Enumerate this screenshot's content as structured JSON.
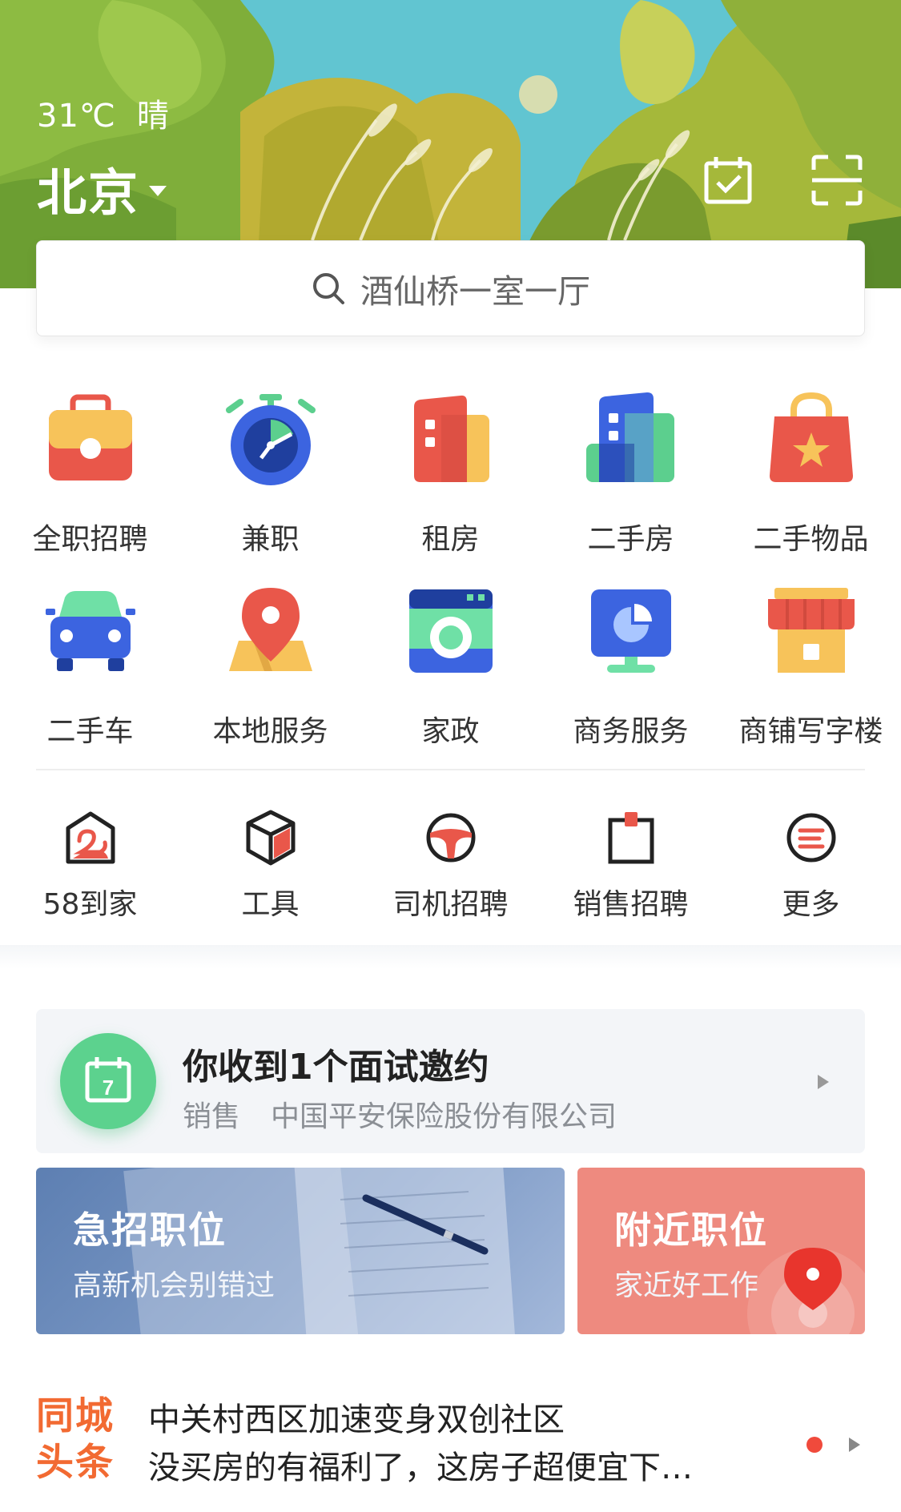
{
  "header": {
    "temperature": "31℃",
    "weather": "晴",
    "city": "北京"
  },
  "search": {
    "placeholder": "酒仙桥一室一厅"
  },
  "grid_row1": [
    {
      "label": "全职招聘",
      "icon": "briefcase-icon"
    },
    {
      "label": "兼职",
      "icon": "stopwatch-icon"
    },
    {
      "label": "租房",
      "icon": "building-icon"
    },
    {
      "label": "二手房",
      "icon": "apartment-icon"
    },
    {
      "label": "二手物品",
      "icon": "shopping-bag-icon"
    }
  ],
  "grid_row2": [
    {
      "label": "二手车",
      "icon": "car-icon"
    },
    {
      "label": "本地服务",
      "icon": "location-map-icon"
    },
    {
      "label": "家政",
      "icon": "washing-machine-icon"
    },
    {
      "label": "商务服务",
      "icon": "monitor-chart-icon"
    },
    {
      "label": "商铺写字楼",
      "icon": "storefront-icon"
    }
  ],
  "grid_row3": [
    {
      "label": "58到家",
      "icon": "swan-home-icon"
    },
    {
      "label": "工具",
      "icon": "cube-icon"
    },
    {
      "label": "司机招聘",
      "icon": "steering-wheel-icon"
    },
    {
      "label": "销售招聘",
      "icon": "clipboard-icon"
    },
    {
      "label": "更多",
      "icon": "menu-circle-icon"
    }
  ],
  "invite": {
    "title": "你收到1个面试邀约",
    "position": "销售",
    "company": "中国平安保险股份有限公司",
    "calendar_day": "7"
  },
  "promos": {
    "urgent": {
      "title": "急招职位",
      "subtitle": "高新机会别错过"
    },
    "nearby": {
      "title": "附近职位",
      "subtitle": "家近好工作"
    }
  },
  "news": {
    "logo_line1": "同城",
    "logo_line2": "头条",
    "headline1": "中关村西区加速变身双创社区",
    "headline2": "没买房的有福利了，这房子超便宜下…"
  },
  "colors": {
    "accent_red": "#f04a3c",
    "invite_green": "#5cd28e",
    "urgent_blue": "#6f8fc0",
    "nearby_coral": "#ee8a7f"
  }
}
